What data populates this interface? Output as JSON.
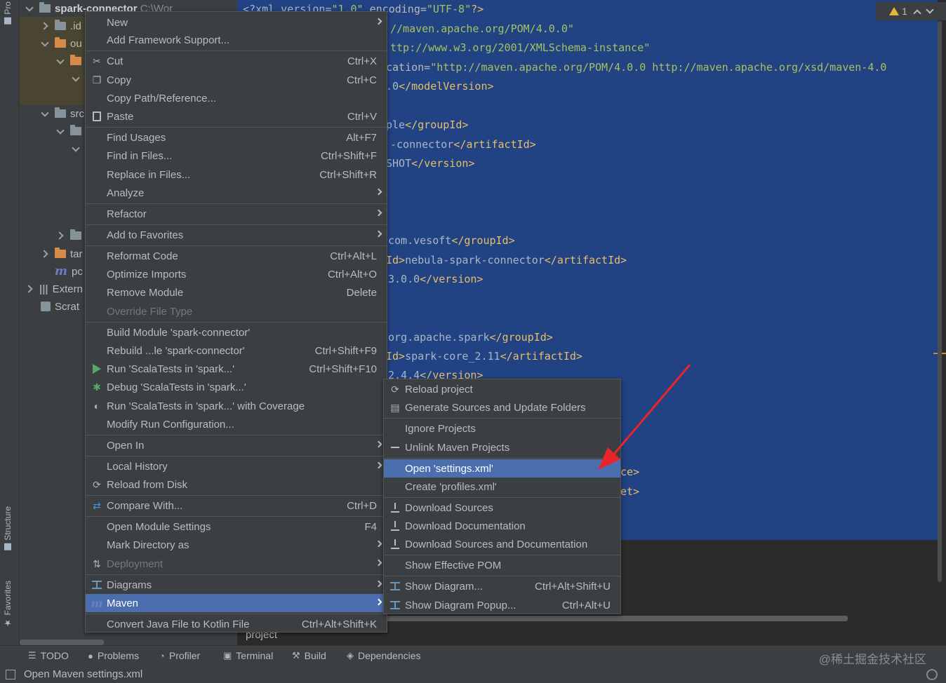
{
  "left_stripe": {
    "tabs": [
      "Pro",
      "Structure",
      "Favorites"
    ]
  },
  "project_tree": {
    "rows": [
      {
        "label": "spark-connector",
        "suffix": "C:\\Wor",
        "expanded": true,
        "bold": true
      },
      {
        "label": ".id"
      },
      {
        "label": "ou"
      },
      {
        "label": ""
      },
      {
        "label": ""
      },
      {
        "label": "src"
      },
      {
        "label": ""
      },
      {
        "label": ""
      },
      {
        "label": ""
      },
      {
        "label": "tar"
      },
      {
        "label": "pc"
      },
      {
        "label": "Extern"
      },
      {
        "label": "Scrat"
      }
    ]
  },
  "editor": {
    "warnings_count": "1",
    "lines": [
      {
        "pre": "<?xml version=",
        "val": "\"1.0\"",
        "mid": " encoding=",
        "val2": "\"UTF-8\"",
        "post": "?>"
      },
      {
        "val": "//maven.apache.org/POM/4.0.0\""
      },
      {
        "val": "ttp://www.w3.org/2001/XMLSchema-instance\""
      },
      {
        "pre": "cation=",
        "val": "\"http://maven.apache.org/POM/4.0.0 http://maven.apache.org/xsd/maven-4.0"
      },
      {
        "x": ".0",
        "post": "</modelVersion>"
      },
      {
        "x": "ple",
        "post": "</groupId>"
      },
      {
        "x": "-connector",
        "post": "</artifactId>"
      },
      {
        "x": "SHOT",
        "post": "</version>"
      },
      {
        "x": "com.vesoft",
        "post": "</groupId>"
      },
      {
        "pre": "Id>",
        "x": "nebula-spark-connector",
        "post": "</artifactId>"
      },
      {
        "x": "3.0.0",
        "post": "</version>"
      },
      {
        "x": "org.apache.spark",
        "post": "</groupId>"
      },
      {
        "pre": "Id>",
        "x": "spark-core_2.11",
        "post": "</artifactId>"
      },
      {
        "x": "2.4.4",
        "post": "</version>"
      },
      {
        "post": "ce>"
      },
      {
        "post": "et>"
      }
    ],
    "path_tail": "project"
  },
  "context_menu": {
    "items": [
      {
        "label": "New",
        "shortcut": "",
        "submenu": true,
        "icon": ""
      },
      {
        "label": "Add Framework Support...",
        "shortcut": "",
        "icon": ""
      },
      {
        "label": "Cut",
        "shortcut": "Ctrl+X",
        "icon": "scissors-icon"
      },
      {
        "label": "Copy",
        "shortcut": "Ctrl+C",
        "icon": "copy-icon"
      },
      {
        "label": "Copy Path/Reference...",
        "shortcut": "",
        "icon": ""
      },
      {
        "label": "Paste",
        "shortcut": "Ctrl+V",
        "icon": "paste-icon"
      },
      {
        "label": "Find Usages",
        "shortcut": "Alt+F7",
        "icon": ""
      },
      {
        "label": "Find in Files...",
        "shortcut": "Ctrl+Shift+F",
        "icon": ""
      },
      {
        "label": "Replace in Files...",
        "shortcut": "Ctrl+Shift+R",
        "icon": ""
      },
      {
        "label": "Analyze",
        "shortcut": "",
        "submenu": true,
        "icon": ""
      },
      {
        "label": "Refactor",
        "shortcut": "",
        "submenu": true,
        "icon": ""
      },
      {
        "label": "Add to Favorites",
        "shortcut": "",
        "submenu": true,
        "icon": ""
      },
      {
        "label": "Reformat Code",
        "shortcut": "Ctrl+Alt+L",
        "icon": ""
      },
      {
        "label": "Optimize Imports",
        "shortcut": "Ctrl+Alt+O",
        "icon": ""
      },
      {
        "label": "Remove Module",
        "shortcut": "Delete",
        "icon": ""
      },
      {
        "label": "Override File Type",
        "shortcut": "",
        "disabled": true,
        "icon": ""
      },
      {
        "label": "Build Module 'spark-connector'",
        "shortcut": "",
        "icon": ""
      },
      {
        "label": "Rebuild ...le 'spark-connector'",
        "shortcut": "Ctrl+Shift+F9",
        "icon": ""
      },
      {
        "label": "Run 'ScalaTests in 'spark...'",
        "shortcut": "Ctrl+Shift+F10",
        "icon": "run-icon"
      },
      {
        "label": "Debug 'ScalaTests in 'spark...'",
        "shortcut": "",
        "icon": "debug-icon"
      },
      {
        "label": "Run 'ScalaTests in 'spark...' with Coverage",
        "shortcut": "",
        "icon": "coverage-icon"
      },
      {
        "label": "Modify Run Configuration...",
        "shortcut": "",
        "icon": ""
      },
      {
        "label": "Open In",
        "shortcut": "",
        "submenu": true,
        "icon": ""
      },
      {
        "label": "Local History",
        "shortcut": "",
        "submenu": true,
        "icon": ""
      },
      {
        "label": "Reload from Disk",
        "shortcut": "",
        "icon": "reload-icon"
      },
      {
        "label": "Compare With...",
        "shortcut": "Ctrl+D",
        "icon": "compare-icon"
      },
      {
        "label": "Open Module Settings",
        "shortcut": "F4",
        "icon": ""
      },
      {
        "label": "Mark Directory as",
        "shortcut": "",
        "submenu": true,
        "icon": ""
      },
      {
        "label": "Deployment",
        "shortcut": "",
        "submenu": true,
        "disabled": true,
        "icon": "deployment-icon"
      },
      {
        "label": "Diagrams",
        "shortcut": "",
        "submenu": true,
        "icon": "diagram-icon"
      },
      {
        "label": "Maven",
        "shortcut": "",
        "submenu": true,
        "selected": true,
        "icon": "maven-icon"
      },
      {
        "label": "Convert Java File to Kotlin File",
        "shortcut": "Ctrl+Alt+Shift+K",
        "icon": ""
      }
    ]
  },
  "maven_submenu": {
    "items": [
      {
        "label": "Reload project",
        "shortcut": "",
        "icon": "reload-icon"
      },
      {
        "label": "Generate Sources and Update Folders",
        "shortcut": "",
        "icon": "generate-sources-icon"
      },
      {
        "label": "Ignore Projects",
        "shortcut": "",
        "icon": ""
      },
      {
        "label": "Unlink Maven Projects",
        "shortcut": "",
        "icon": "minus-icon"
      },
      {
        "label": "Open 'settings.xml'",
        "shortcut": "",
        "selected": true,
        "icon": ""
      },
      {
        "label": "Create 'profiles.xml'",
        "shortcut": "",
        "icon": ""
      },
      {
        "label": "Download Sources",
        "shortcut": "",
        "icon": "download-icon"
      },
      {
        "label": "Download Documentation",
        "shortcut": "",
        "icon": "download-icon"
      },
      {
        "label": "Download Sources and Documentation",
        "shortcut": "",
        "icon": "download-icon"
      },
      {
        "label": "Show Effective POM",
        "shortcut": "",
        "icon": ""
      },
      {
        "label": "Show Diagram...",
        "shortcut": "Ctrl+Alt+Shift+U",
        "icon": "diagram-icon"
      },
      {
        "label": "Show Diagram Popup...",
        "shortcut": "Ctrl+Alt+U",
        "icon": "diagram-icon"
      }
    ]
  },
  "tool_windows": [
    {
      "label": "TODO",
      "icon": "list-icon"
    },
    {
      "label": "Problems",
      "icon": "info-icon"
    },
    {
      "label": "Profiler",
      "icon": "profiler-icon"
    },
    {
      "label": "Terminal",
      "icon": "terminal-icon"
    },
    {
      "label": "Build",
      "icon": "hammer-icon"
    },
    {
      "label": "Dependencies",
      "icon": "dependencies-icon"
    }
  ],
  "watermark": "@稀土掘金技术社区",
  "status_bar": {
    "text": "Open Maven settings.xml"
  },
  "colors": {
    "menu_bg": "#3c3f41",
    "selection": "#4b6eaf",
    "editor_selection": "#214283",
    "arrow": "#e8252a"
  }
}
